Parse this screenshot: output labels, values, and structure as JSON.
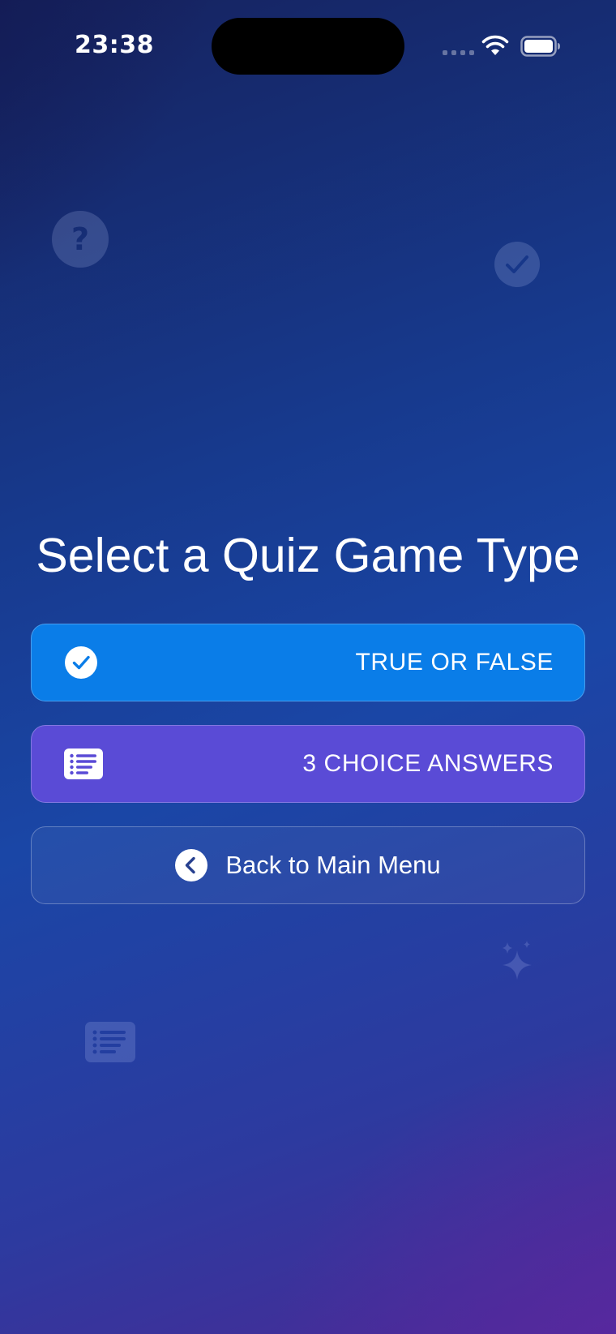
{
  "status_bar": {
    "time": "23:38"
  },
  "background_icons": {
    "question_mark": "?"
  },
  "title": "Select a Quiz Game Type",
  "options": [
    {
      "label": "TRUE OR FALSE",
      "icon": "checkmark-circle-icon",
      "color": "#0a7de8"
    },
    {
      "label": "3 CHOICE ANSWERS",
      "icon": "list-icon",
      "color": "#5a4bd6"
    }
  ],
  "back_button": {
    "label": "Back to Main Menu",
    "icon": "chevron-left-circle-icon"
  },
  "colors": {
    "background_top": "#16225e",
    "background_mid": "#1a46a6",
    "background_bottom": "#4a2a96"
  }
}
